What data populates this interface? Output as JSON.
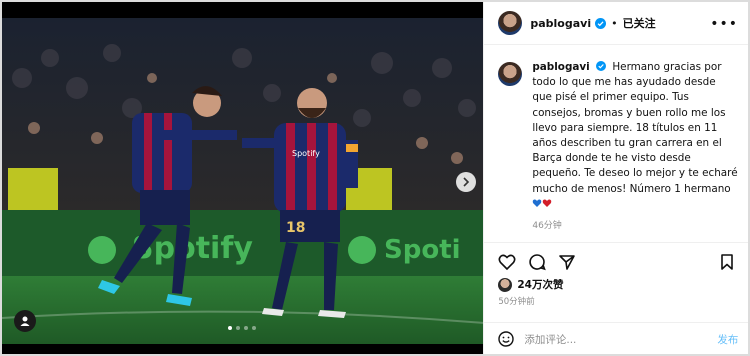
{
  "post": {
    "username": "pablogavi",
    "follow_status": "已关注",
    "caption_username": "pablogavi",
    "caption_text": "Hermano gracias por todo lo que me has ayudado desde que pisé el primer equipo. Tus consejos, bromas y buen rollo me los llevo para siempre. 18 títulos en 11 años describen tu gran carrera en el Barça donde te he visto desde pequeño. Te deseo lo mejor y te echaré mucho de menos! Número 1 hermano",
    "caption_time": "46分钟",
    "likes": "24万次赞",
    "post_time": "50分钟前",
    "comment_placeholder": "添加评论...",
    "post_button": "发布",
    "heart_colors": [
      "#1f6fd1",
      "#d31f2a"
    ],
    "carousel": {
      "count": 4,
      "active_index": 0
    },
    "photo": {
      "ad_board_text": "Spotify",
      "jersey_sponsor": "Spotify",
      "jersey_number": "18"
    }
  }
}
